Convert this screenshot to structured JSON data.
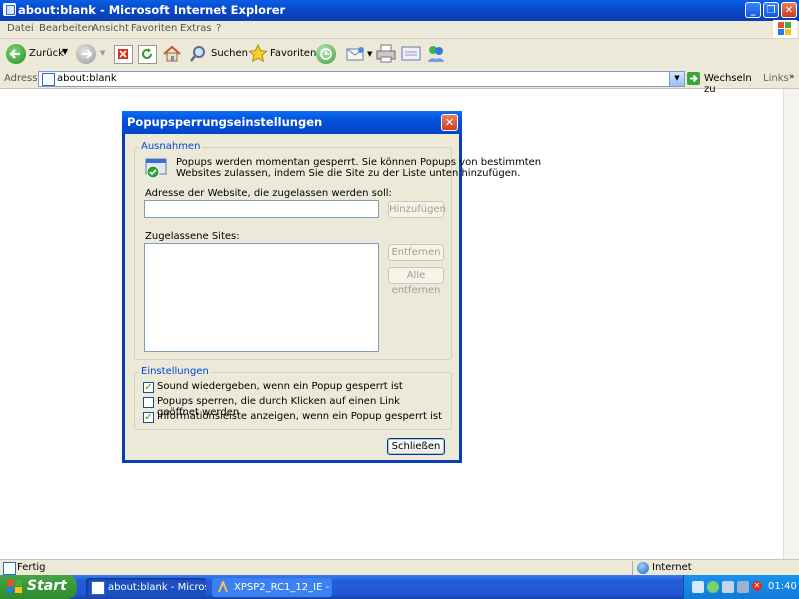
{
  "window": {
    "title": "about:blank - Microsoft Internet Explorer",
    "minimize_glyph": "_",
    "maximize_glyph": "❐",
    "close_glyph": "✕"
  },
  "menu": {
    "items": [
      "Datei",
      "Bearbeiten",
      "Ansicht",
      "Favoriten",
      "Extras",
      "?"
    ]
  },
  "toolbar": {
    "back_label": "Zurück",
    "search_label": "Suchen",
    "favorites_label": "Favoriten"
  },
  "address": {
    "label": "Adresse",
    "value": "about:blank",
    "go_label": "Wechseln zu",
    "links_label": "Links"
  },
  "dialog": {
    "title": "Popupsperrungseinstellungen",
    "exceptions_legend": "Ausnahmen",
    "info_line1": "Popups werden momentan gesperrt. Sie können Popups von bestimmten",
    "info_line2": "Websites zulassen, indem Sie die Site zu der Liste unten hinzufügen.",
    "address_label": "Adresse der Website, die zugelassen werden soll:",
    "address_value": "",
    "add_button": "Hinzufügen",
    "allowed_label": "Zugelassene Sites:",
    "allowed_sites": [],
    "remove_button": "Entfernen",
    "remove_all_button": "Alle entfernen",
    "settings_legend": "Einstellungen",
    "options": [
      {
        "label": "Sound wiedergeben, wenn ein Popup gesperrt ist",
        "checked": true
      },
      {
        "label": "Popups sperren, die durch Klicken auf einen Link geöffnet werden",
        "checked": false
      },
      {
        "label": "Informationsleiste anzeigen, wenn ein Popup gesperrt ist",
        "checked": true
      }
    ],
    "close_button": "Schließen"
  },
  "status": {
    "text": "Fertig",
    "zone": "Internet"
  },
  "taskbar": {
    "start_label": "Start",
    "tasks": [
      "about:blank - Microso...",
      "XPSP2_RC1_12_IE - ..."
    ],
    "clock": "01:40"
  },
  "colors": {
    "titlebar_blue": "#0747c8",
    "dialog_face": "#ece9d8",
    "legend_blue": "#0046d5",
    "taskbar_blue": "#245edb",
    "start_green": "#3a9a3a"
  }
}
